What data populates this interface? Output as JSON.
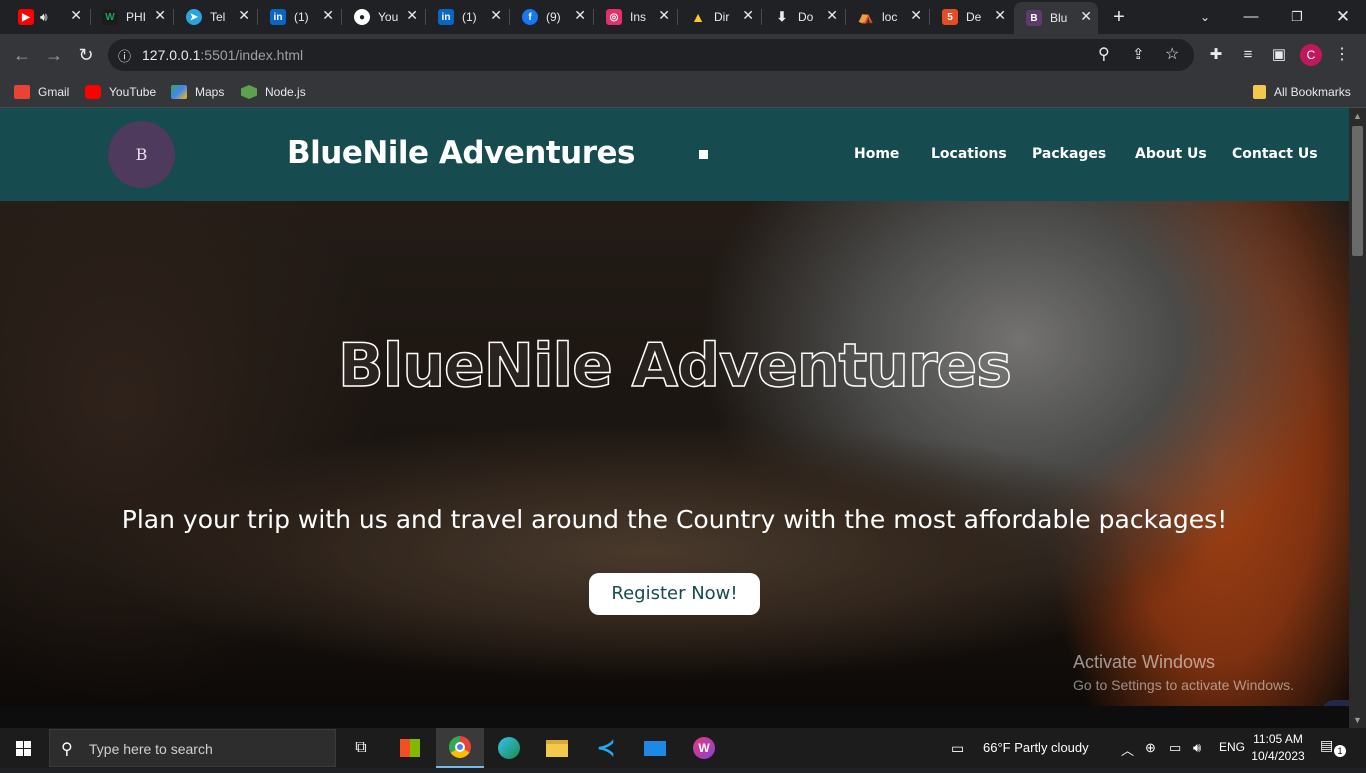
{
  "browser": {
    "tabs": [
      {
        "title": "",
        "icon": "youtube-audio-icon",
        "color": "#ff0000"
      },
      {
        "title": "PHI",
        "icon": "w-icon",
        "color": "#1aa260"
      },
      {
        "title": "Tel",
        "icon": "telegram-icon",
        "color": "#2aa3e0"
      },
      {
        "title": "(1)",
        "icon": "linkedin-icon",
        "color": "#0a66c2"
      },
      {
        "title": "You",
        "icon": "github-icon",
        "color": "#ffffff"
      },
      {
        "title": "(1)",
        "icon": "linkedin-icon",
        "color": "#0a66c2"
      },
      {
        "title": "(9)",
        "icon": "facebook-icon",
        "color": "#1877f2"
      },
      {
        "title": "Ins",
        "icon": "instagram-icon",
        "color": "#e1306c"
      },
      {
        "title": "Dir",
        "icon": "firebase-icon",
        "color": "#ffca28"
      },
      {
        "title": "Do",
        "icon": "download-icon",
        "color": "#e8eaed"
      },
      {
        "title": "loc",
        "icon": "local-icon",
        "color": "#f4a261"
      },
      {
        "title": "De",
        "icon": "html-icon",
        "color": "#e44d26"
      },
      {
        "title": "Blu",
        "icon": "bluenile-icon",
        "color": "#5e3a6e",
        "active": true
      }
    ],
    "url_host": "127.0.0.1",
    "url_path": ":5501/index.html",
    "profile_initial": "C",
    "bookmarks": [
      {
        "label": "Gmail",
        "icon": "gmail-icon"
      },
      {
        "label": "YouTube",
        "icon": "youtube-icon"
      },
      {
        "label": "Maps",
        "icon": "maps-icon"
      },
      {
        "label": "Node.js",
        "icon": "nodejs-icon"
      }
    ],
    "all_bookmarks": "All Bookmarks"
  },
  "site": {
    "logo_text": "B",
    "brand": "BlueNile Adventures",
    "nav": [
      "Home",
      "Locations",
      "Packages",
      "About Us",
      "Contact Us"
    ],
    "hero_title": "BlueNile Adventures",
    "hero_subtitle": "Plan your trip with us and travel around the Country with the most affordable packages!",
    "cta": "Register Now!"
  },
  "watermark": {
    "line1": "Activate Windows",
    "line2": "Go to Settings to activate Windows."
  },
  "taskbar": {
    "search_placeholder": "Type here to search",
    "weather": "66°F  Partly cloudy",
    "language": "ENG",
    "time": "11:05 AM",
    "date": "10/4/2023",
    "notifications": "1"
  },
  "colors": {
    "navbar": "#164b4f",
    "brand_text": "#ffffff",
    "cta_bg": "#ffffff"
  }
}
